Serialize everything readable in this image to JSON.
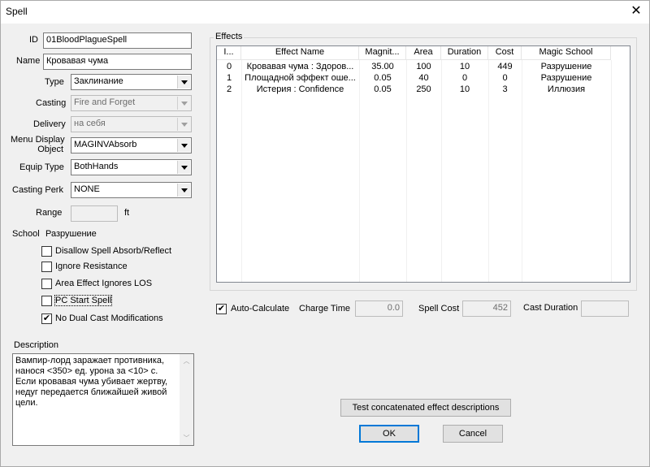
{
  "window": {
    "title": "Spell"
  },
  "fields": {
    "id_label": "ID",
    "id_value": "01BloodPlagueSpell",
    "name_label": "Name",
    "name_value": "Кровавая чума",
    "type_label": "Type",
    "type_value": "Заклинание",
    "casting_label": "Casting",
    "casting_value": "Fire and Forget",
    "delivery_label": "Delivery",
    "delivery_value": "на себя",
    "menu_display_label_1": "Menu Display",
    "menu_display_label_2": "Object",
    "menu_display_value": "MAGINVAbsorb",
    "equip_type_label": "Equip Type",
    "equip_type_value": "BothHands",
    "casting_perk_label": "Casting Perk",
    "casting_perk_value": "NONE",
    "range_label": "Range",
    "range_unit": "ft",
    "range_value": "",
    "school_label": "School",
    "school_value": "Разрушение"
  },
  "checkboxes": [
    {
      "label": "Disallow Spell Absorb/Reflect",
      "checked": false
    },
    {
      "label": "Ignore Resistance",
      "checked": false
    },
    {
      "label": "Area Effect Ignores LOS",
      "checked": false
    },
    {
      "label": "PC Start Spell",
      "checked": false
    },
    {
      "label": "No Dual Cast Modifications",
      "checked": true
    }
  ],
  "description": {
    "label": "Description",
    "text": "Вампир-лорд заражает противника, нанося <350> ед. урона за <10> с. Если кровавая чума убивает жертву, недуг передается ближайшей живой цели."
  },
  "effects": {
    "label": "Effects",
    "columns": [
      "I...",
      "Effect Name",
      "Magnit...",
      "Area",
      "Duration",
      "Cost",
      "Magic School"
    ],
    "rows": [
      [
        "0",
        "Кровавая чума : Здоров...",
        "35.00",
        "100",
        "10",
        "449",
        "Разрушение"
      ],
      [
        "1",
        "Площадной эффект оше...",
        "0.05",
        "40",
        "0",
        "0",
        "Разрушение"
      ],
      [
        "2",
        "Истерия : Confidence",
        "0.05",
        "250",
        "10",
        "3",
        "Иллюзия"
      ]
    ]
  },
  "calc": {
    "auto_calculate_label": "Auto-Calculate",
    "auto_calculate_checked": true,
    "charge_time_label": "Charge Time",
    "charge_time_value": "0.0",
    "spell_cost_label": "Spell Cost",
    "spell_cost_value": "452",
    "cast_duration_label": "Cast Duration",
    "cast_duration_value": ""
  },
  "buttons": {
    "test_label": "Test concatenated effect descriptions",
    "ok_label": "OK",
    "cancel_label": "Cancel"
  },
  "icons": {
    "close": "close-icon",
    "combo_arrow": "chevron-down-icon",
    "check": "checkmark-icon"
  }
}
